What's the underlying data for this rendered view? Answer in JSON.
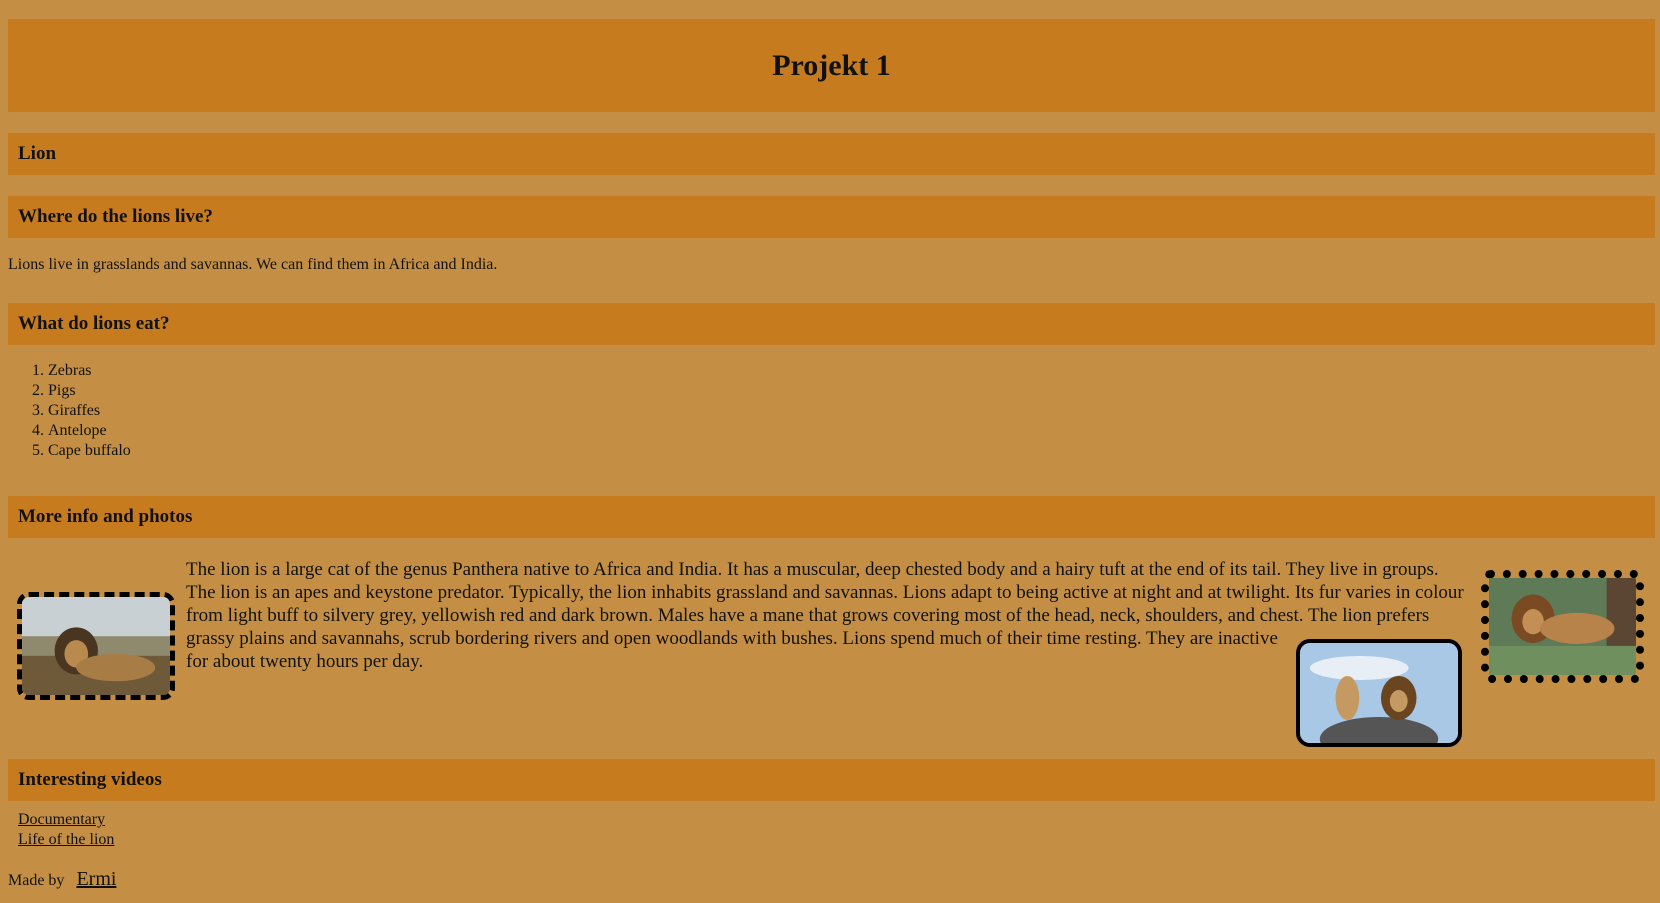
{
  "header": {
    "title": "Projekt 1"
  },
  "sections": {
    "lion": {
      "title": "Lion"
    },
    "where": {
      "title": "Where do the lions live?",
      "text": "Lions live in grasslands and savannas. We can find them in Africa and India."
    },
    "eat": {
      "title": "What do lions eat?",
      "items": [
        "Zebras",
        "Pigs",
        "Giraffes",
        "Antelope",
        "Cape buffalo"
      ]
    },
    "more": {
      "title": "More info and photos",
      "text": "The lion is a large cat of the genus Panthera native to Africa and India. It has a muscular, deep chested body and a hairy tuft at the end of its tail. They live in groups. The lion is an apes and keystone predator. Typically, the lion inhabits grassland and savannas. Lions adapt to being active at night and at twilight. Its fur varies in colour from light buff to silvery grey, yellowish red and dark brown. Males have a mane that grows covering most of the head, neck, shoulders, and chest. The lion prefers grassy plains and savannahs, scrub bordering rivers and open woodlands with bushes. Lions spend much of their time resting. They are inactive for about twenty hours per day."
    },
    "videos": {
      "title": "Interesting videos",
      "links": [
        "Documentary",
        "Life of the lion"
      ]
    }
  },
  "footer": {
    "made_by_label": "Made by",
    "author_link": "Ermi"
  },
  "colors": {
    "background": "#c48f45",
    "bar": "#c57b1e"
  }
}
